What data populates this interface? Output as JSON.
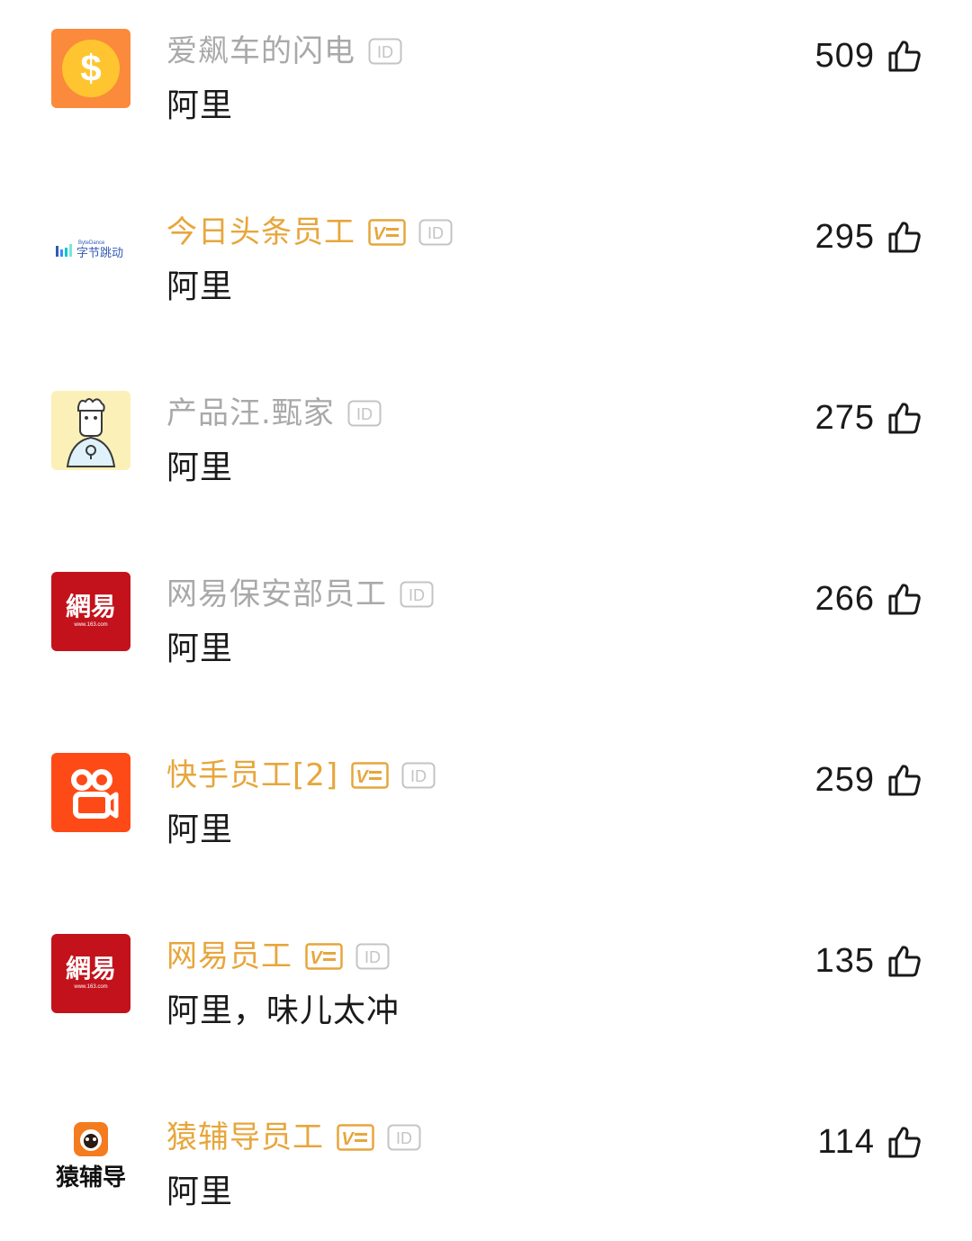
{
  "comments": [
    {
      "name": "爱飙车的闪电",
      "name_style": "plain",
      "vip": false,
      "id_label": "ID",
      "text": "阿里",
      "likes": "509",
      "avatar_icon": "dollar-coin-icon"
    },
    {
      "name": "今日头条员工",
      "name_style": "vip",
      "vip": true,
      "vip_label": "V",
      "id_label": "ID",
      "text": "阿里",
      "likes": "295",
      "avatar_icon": "bytedance-logo",
      "avatar_text_top": "ByteDance",
      "avatar_text": "字节跳动"
    },
    {
      "name": "产品汪.甄家",
      "name_style": "plain",
      "vip": false,
      "id_label": "ID",
      "text": "阿里",
      "likes": "275",
      "avatar_icon": "cartoon-person-icon"
    },
    {
      "name": "网易保安部员工",
      "name_style": "plain",
      "vip": false,
      "id_label": "ID",
      "text": "阿里",
      "likes": "266",
      "avatar_icon": "netease-logo",
      "avatar_text": "網易",
      "avatar_subtext": "www.163.com"
    },
    {
      "name": "快手员工[2]",
      "name_style": "vip",
      "vip": true,
      "vip_label": "V",
      "id_label": "ID",
      "text": "阿里",
      "likes": "259",
      "avatar_icon": "kuaishou-logo"
    },
    {
      "name": "网易员工",
      "name_style": "vip",
      "vip": true,
      "vip_label": "V",
      "id_label": "ID",
      "text": "阿里，味儿太冲",
      "likes": "135",
      "avatar_icon": "netease-logo",
      "avatar_text": "網易",
      "avatar_subtext": "www.163.com"
    },
    {
      "name": "猿辅导员工",
      "name_style": "vip",
      "vip": true,
      "vip_label": "V",
      "id_label": "ID",
      "text": "阿里",
      "likes": "114",
      "avatar_icon": "yuanfudao-logo",
      "avatar_text": "猿辅导"
    }
  ],
  "colors": {
    "vip_gold": "#e7a63c",
    "plain_name": "#a9a9a9",
    "text": "#1a1a1a",
    "netease_red": "#c3121c",
    "kuaishou_orange": "#fe4a17",
    "coin_orange": "#fb8a3c",
    "coin_yellow": "#fec531"
  },
  "icons": {
    "like": "thumbs-up-icon",
    "vip_badge": "vip-v-badge-icon",
    "id_badge": "id-badge-icon"
  }
}
